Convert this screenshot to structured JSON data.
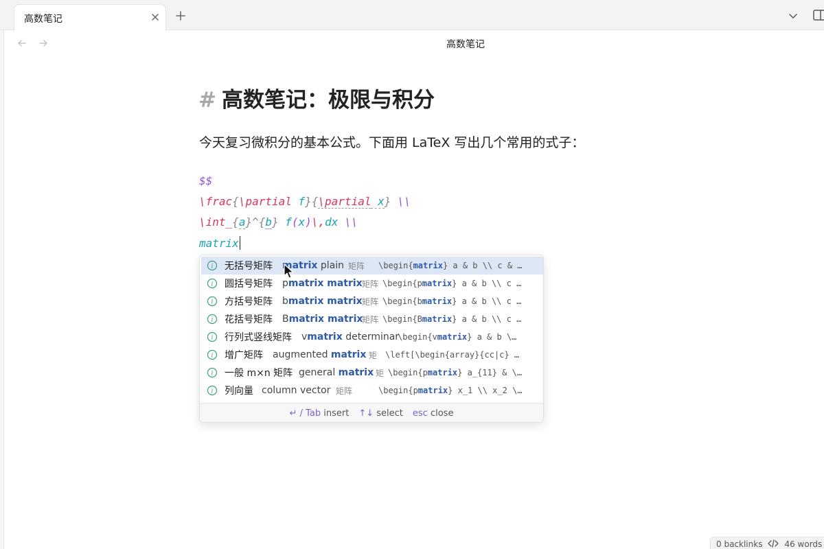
{
  "tabs": {
    "active_title": "高数笔记",
    "close_icon": "close-icon",
    "new_tab_icon": "plus-icon"
  },
  "view": {
    "title": "高数笔记",
    "back_icon": "arrow-left-icon",
    "forward_icon": "arrow-right-icon"
  },
  "note": {
    "heading_hash": "#",
    "heading": "高数笔记：极限与积分",
    "paragraph": "今天复习微积分的基本公式。下面用 LaTeX 写出几个常用的式子：",
    "code": {
      "l1": "$$",
      "l2": {
        "a": "\\frac",
        "b": "{",
        "c": "\\partial",
        "d": " f",
        "e": "}{",
        "f": "\\partial",
        "g": " x",
        "h": "} ",
        "i": "\\\\"
      },
      "l3": {
        "a": "\\int_",
        "b": "{",
        "c": "a",
        "d": "}^{",
        "e": "b",
        "f": "} ",
        "g": "f",
        "h": "(",
        "i": "x",
        "j": ")",
        "k": "\\,",
        "l": "dx ",
        "m": "\\\\"
      },
      "l4": "matrix"
    }
  },
  "autocomplete": {
    "items": [
      {
        "cn": "无括号矩阵",
        "en_pre": "",
        "en_match": "matrix",
        "en_post": " plain",
        "cat": "矩阵",
        "code_pre": "\\begin{",
        "code_match": "matrix",
        "code_post": "} a & b \\\\ c & …"
      },
      {
        "cn": "圆括号矩阵",
        "en_pre": "p",
        "en_match": "matrix matrix",
        "en_post": "",
        "cat": "矩阵",
        "code_pre": "\\begin{p",
        "code_match": "matrix",
        "code_post": "} a & b \\\\ c …"
      },
      {
        "cn": "方括号矩阵",
        "en_pre": "b",
        "en_match": "matrix matrix",
        "en_post": "",
        "cat": "矩阵",
        "code_pre": "\\begin{b",
        "code_match": "matrix",
        "code_post": "} a & b \\\\ c …"
      },
      {
        "cn": "花括号矩阵",
        "en_pre": "B",
        "en_match": "matrix matrix",
        "en_post": "",
        "cat": "矩阵",
        "code_pre": "\\begin{B",
        "code_match": "matrix",
        "code_post": "} a & b \\\\ c …"
      },
      {
        "cn": "行列式竖线矩阵",
        "en_pre": "v",
        "en_match": "matrix",
        "en_post": " determinar",
        "cat": "",
        "code_pre": "\\begin{v",
        "code_match": "matrix",
        "code_post": "} a & b \\…"
      },
      {
        "cn": "增广矩阵",
        "en_pre": "augmented ",
        "en_match": "matrix",
        "en_post": "",
        "cat": "矩",
        "code_pre": "\\left[\\begin{array}{cc|c} …",
        "code_match": "",
        "code_post": ""
      },
      {
        "cn": "一般 m×n 矩阵",
        "en_pre": "general ",
        "en_match": "matrix",
        "en_post": "",
        "cat": "矩",
        "code_pre": "\\begin{p",
        "code_match": "matrix",
        "code_post": "} a_{11} & \\…"
      },
      {
        "cn": "列向量",
        "en_pre": "column vector",
        "en_match": "",
        "en_post": "",
        "cat": "矩阵",
        "code_pre": "\\begin{p",
        "code_match": "matrix",
        "code_post": "} x_1 \\\\ x_2 \\…"
      }
    ],
    "footer": {
      "insert_key": "↵ / Tab",
      "insert_label": "insert",
      "select_key": "↑↓",
      "select_label": "select",
      "close_key": "esc",
      "close_label": "close"
    }
  },
  "status": {
    "backlinks": "0 backlinks",
    "code_icon": "code-icon",
    "words": "46 words"
  },
  "colors": {
    "latex_delim": "#9155d8",
    "latex_command": "#d8365c",
    "latex_arg": "#1aa3b3",
    "match_highlight": "#2f5aa8",
    "active_row": "#dde6f5"
  }
}
